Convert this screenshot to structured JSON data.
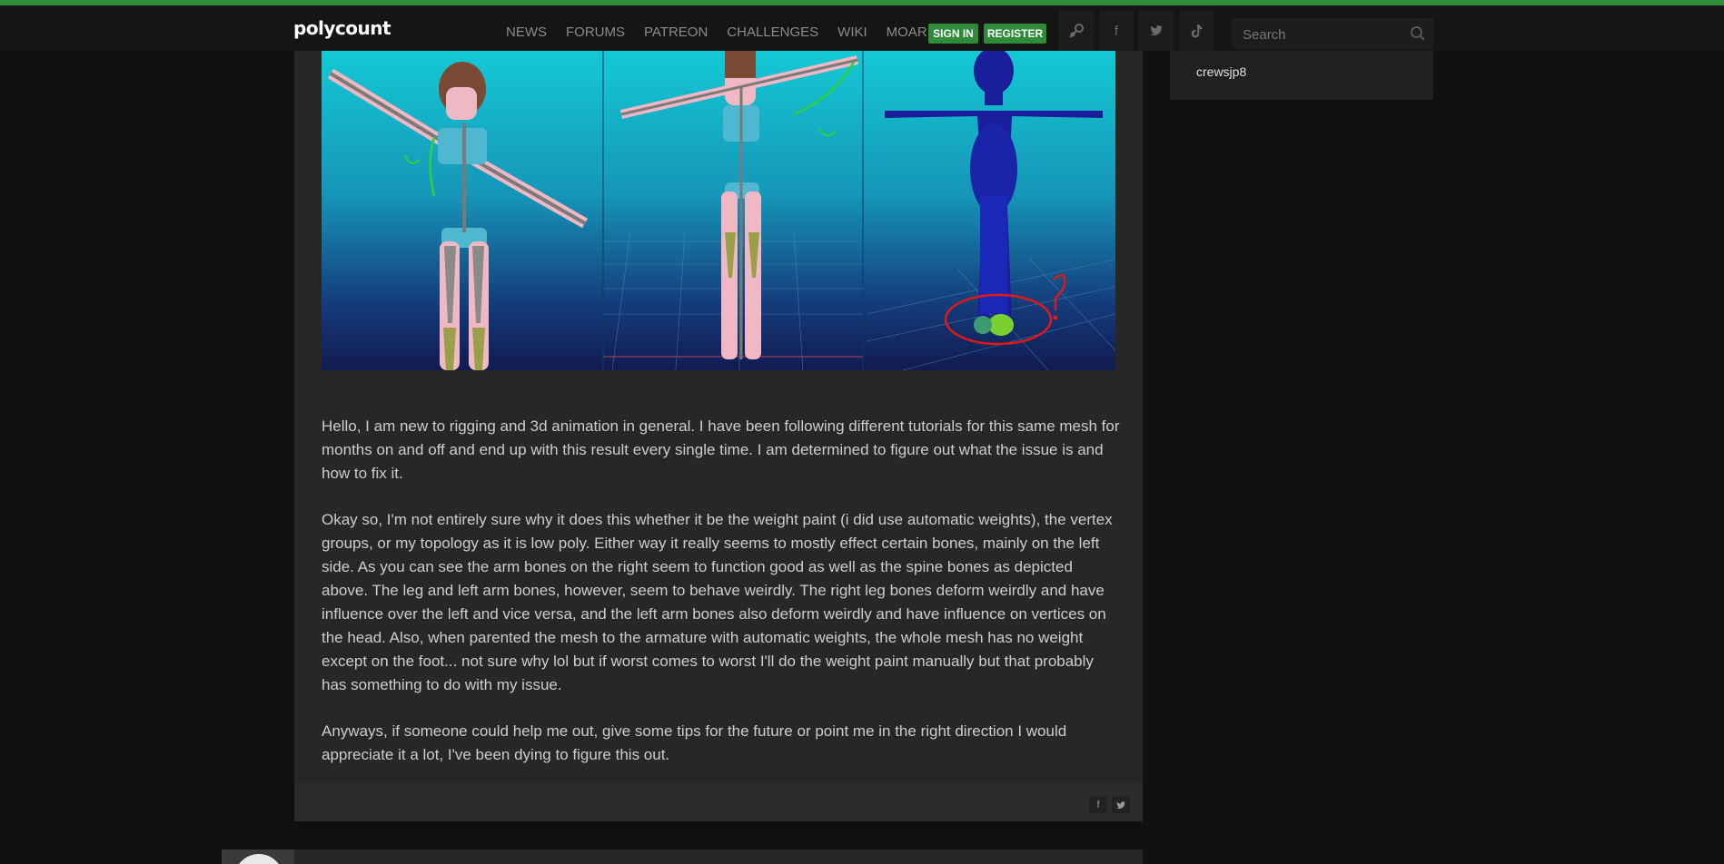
{
  "site": {
    "logo": "polycount"
  },
  "nav": {
    "items": [
      "NEWS",
      "FORUMS",
      "PATREON",
      "CHALLENGES",
      "WIKI",
      "MOAR"
    ]
  },
  "auth": {
    "sign_in": "SIGN IN",
    "register": "REGISTER"
  },
  "social_icons": [
    "steam-icon",
    "facebook-icon",
    "twitter-icon",
    "tiktok-icon"
  ],
  "search": {
    "placeholder": "Search",
    "value": ""
  },
  "sidebar": {
    "username": "crewsjp8"
  },
  "post": {
    "paragraphs": [
      "Hello, I am new to rigging and 3d animation in general. I have been following different tutorials for this same mesh for months on and off and end up with this result every single time. I am determined to figure out what the issue is and how to fix it.",
      "Okay so, I'm not entirely sure why it does this whether it be the weight paint (i did use automatic weights), the vertex groups, or my topology as it is low poly. Either way it really seems to mostly effect certain bones, mainly on the left side. As you can see the arm bones on the right seem to function good as well as the spine bones as depicted above. The leg and left arm bones, however, seem to behave weirdly. The right leg bones deform weirdly and have influence over the left and vice versa, and the left arm bones also deform weirdly and have influence on vertices on the head. Also, when parented the mesh to the armature with automatic weights, the whole mesh has no weight except on the foot... not sure why lol but if worst comes to worst I'll do the weight paint manually but that probably has something to do with my issue.",
      "Anyways, if someone could help me out, give some tips for the future or point me in the right direction I would appreciate it a lot, I've been dying to figure this out."
    ],
    "share": [
      "facebook-icon",
      "twitter-icon"
    ]
  },
  "colors": {
    "accent": "#2f8a3a",
    "background": "#101010",
    "panel": "#272727"
  }
}
